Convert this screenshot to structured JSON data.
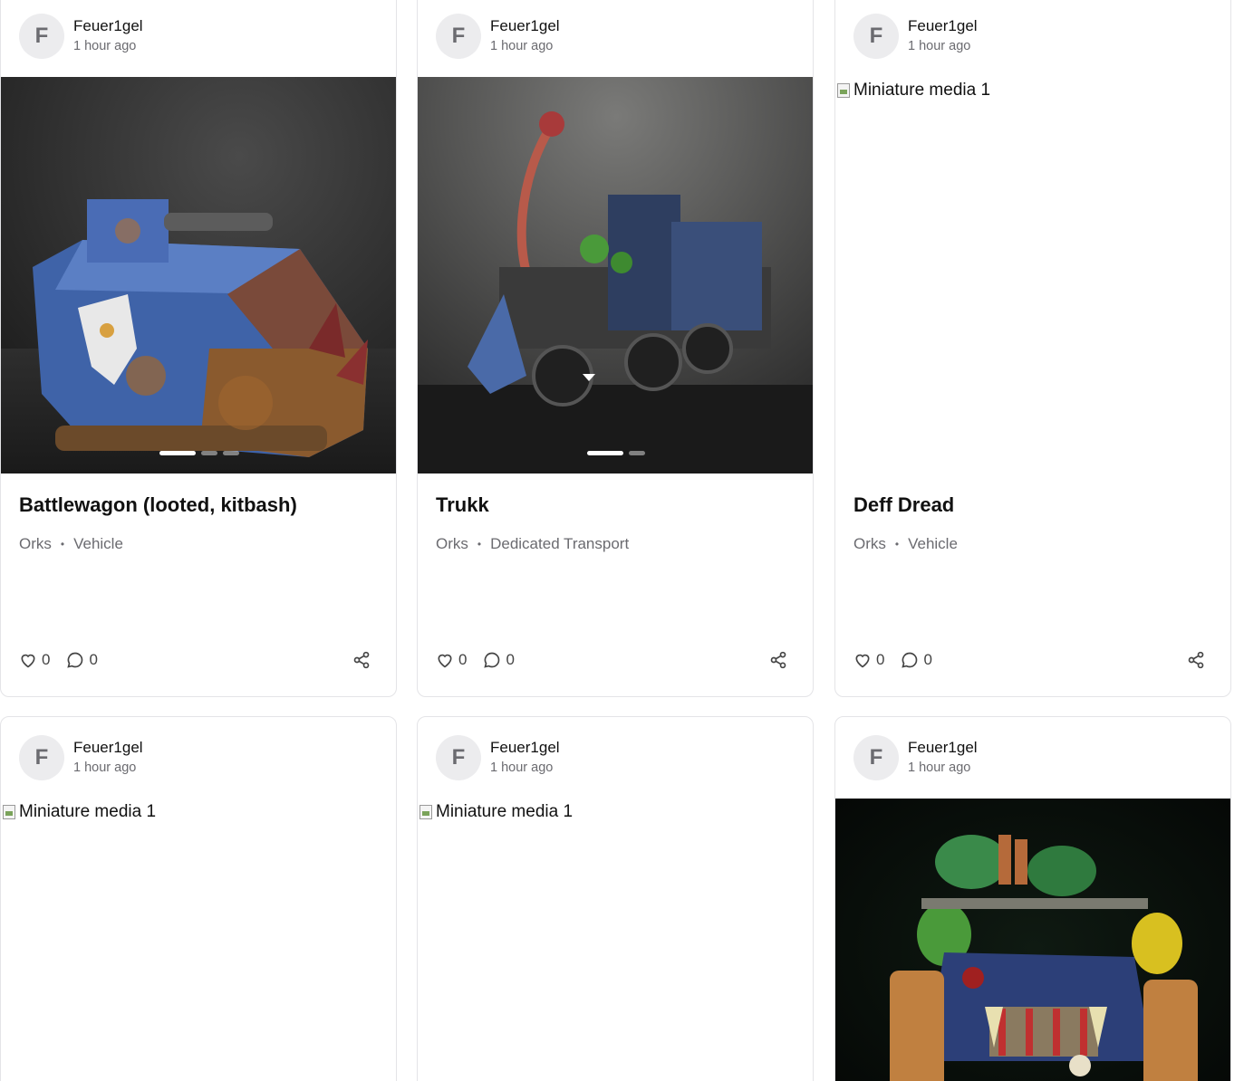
{
  "posts": [
    {
      "author_initial": "F",
      "author_name": "Feuer1gel",
      "time": "1 hour ago",
      "title": "Battlewagon (looted, kitbash)",
      "faction": "Orks",
      "category": "Vehicle",
      "likes": "0",
      "comments": "0",
      "media_alt": "",
      "media_status": "loaded",
      "carousel": {
        "count": 3,
        "active": 1
      }
    },
    {
      "author_initial": "F",
      "author_name": "Feuer1gel",
      "time": "1 hour ago",
      "title": "Trukk",
      "faction": "Orks",
      "category": "Dedicated Transport",
      "likes": "0",
      "comments": "0",
      "media_alt": "",
      "media_status": "loaded",
      "carousel": {
        "count": 2,
        "active": 1
      }
    },
    {
      "author_initial": "F",
      "author_name": "Feuer1gel",
      "time": "1 hour ago",
      "title": "Deff Dread",
      "faction": "Orks",
      "category": "Vehicle",
      "likes": "0",
      "comments": "0",
      "media_alt": "Miniature media 1",
      "media_status": "broken"
    },
    {
      "author_initial": "F",
      "author_name": "Feuer1gel",
      "time": "1 hour ago",
      "media_alt": "Miniature media 1",
      "media_status": "broken"
    },
    {
      "author_initial": "F",
      "author_name": "Feuer1gel",
      "time": "1 hour ago",
      "media_alt": "Miniature media 1",
      "media_status": "broken"
    },
    {
      "author_initial": "F",
      "author_name": "Feuer1gel",
      "time": "1 hour ago",
      "media_alt": "",
      "media_status": "loaded"
    }
  ],
  "icons": {
    "like": "heart-icon",
    "comment": "comment-bubble-icon",
    "share": "share-icon"
  },
  "colors": {
    "card_border": "#e4e4e7",
    "avatar_bg": "#ececee",
    "muted_text": "#6b6b70",
    "text": "#111111"
  }
}
